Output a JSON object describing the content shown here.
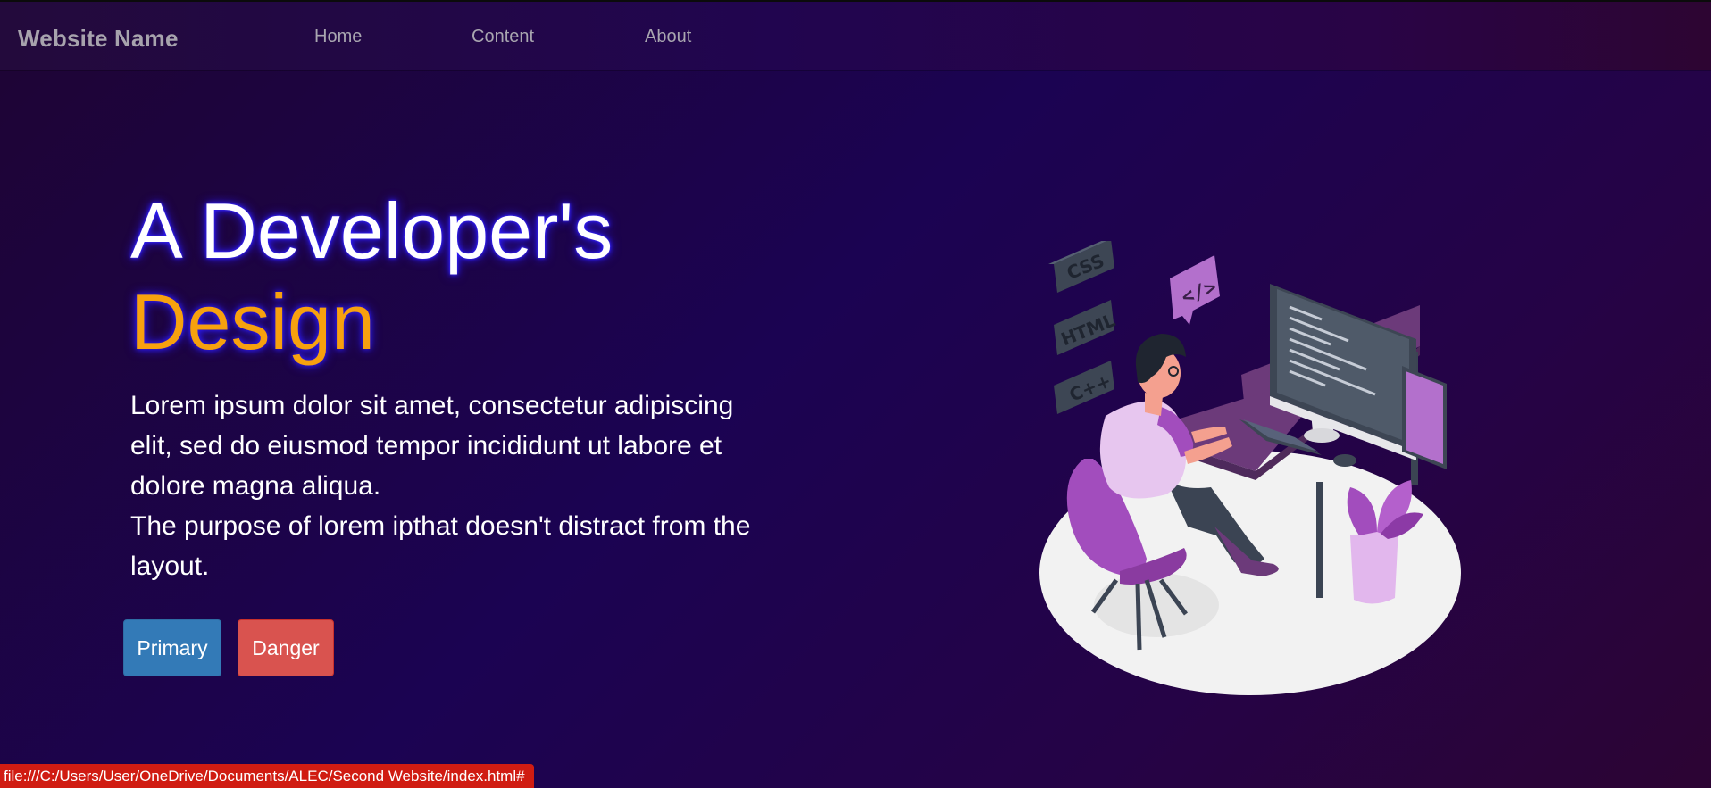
{
  "nav": {
    "brand": "Website Name",
    "links": [
      "Home",
      "Content",
      "About"
    ]
  },
  "hero": {
    "title_line1": "A Developer's",
    "title_line2": "Design",
    "paragraph1": "Lorem ipsum dolor sit amet, consectetur adipiscing elit, sed do eiusmod tempor incididunt ut labore et dolore magna aliqua.",
    "paragraph2": "The purpose of lorem ipthat doesn't distract from the layout.",
    "buttons": {
      "primary": "Primary",
      "danger": "Danger"
    }
  },
  "illustration": {
    "icon": "developer-at-desk-illustration",
    "badges": [
      "CSS",
      "HTML",
      "C++",
      "</>"
    ]
  },
  "status_bar": {
    "url": "file:///C:/Users/User/OneDrive/Documents/ALEC/Second Website/index.html#"
  },
  "colors": {
    "background": "#1b0352",
    "accent": "#f7a10e",
    "primary": "#337ab7",
    "danger": "#d9534f",
    "status_bar": "#d01c12"
  }
}
